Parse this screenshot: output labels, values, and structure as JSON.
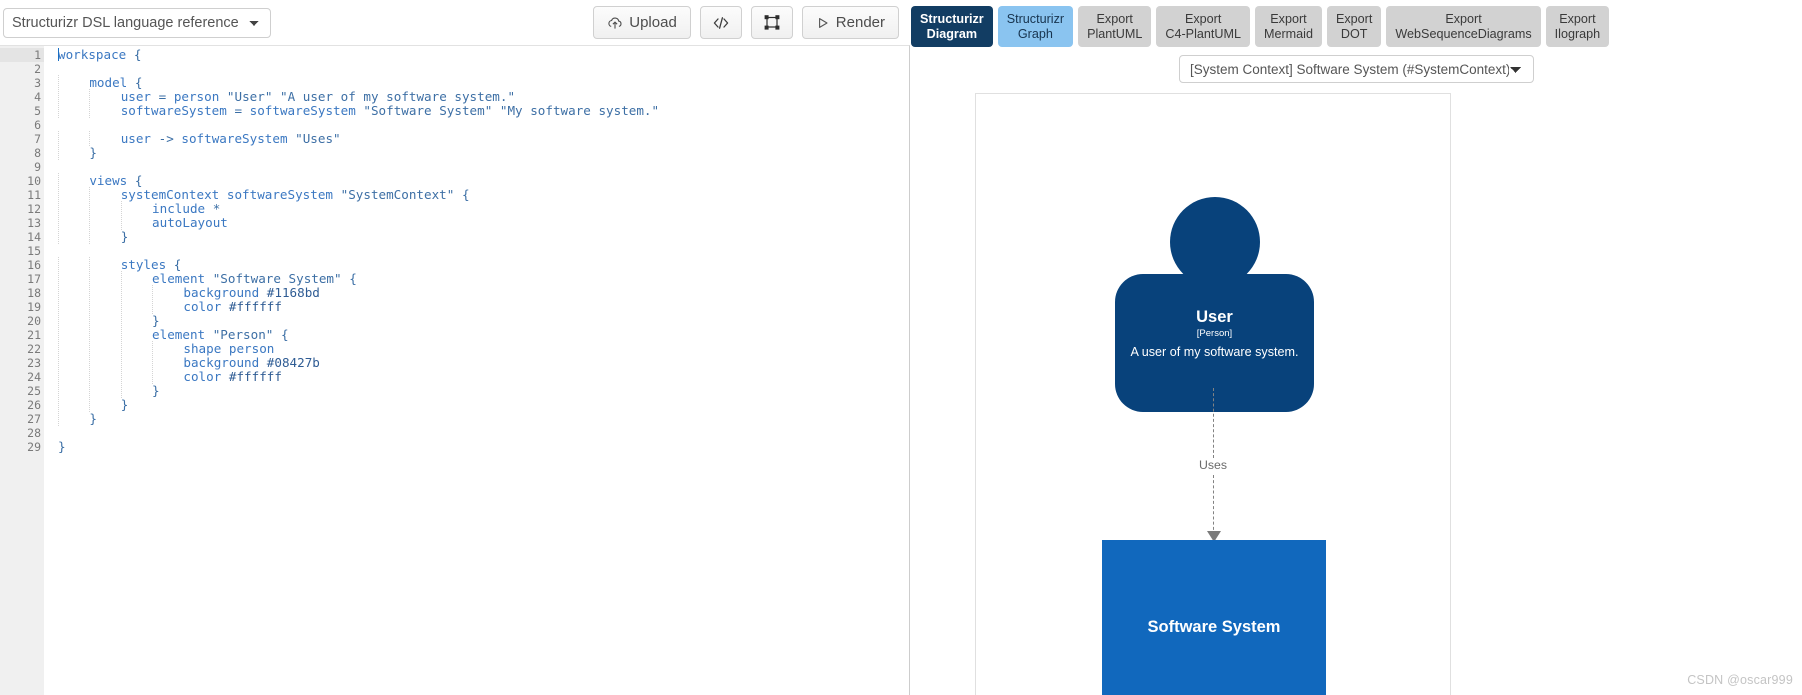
{
  "editor": {
    "language_select": {
      "value": "Structurizr DSL language reference",
      "options": [
        "Structurizr DSL language reference"
      ]
    },
    "toolbar": {
      "upload_label": "Upload",
      "code_icon": "code-brackets-icon",
      "fullscreen_icon": "bounding-box-icon",
      "render_label": "Render",
      "upload_icon": "cloud-upload-icon",
      "render_icon": "play-triangle-icon"
    },
    "lines": [
      {
        "n": 1,
        "fold": true,
        "indent": 0,
        "text": "workspace {"
      },
      {
        "n": 2,
        "fold": false,
        "indent": 0,
        "text": ""
      },
      {
        "n": 3,
        "fold": true,
        "indent": 1,
        "text": "model {"
      },
      {
        "n": 4,
        "fold": false,
        "indent": 2,
        "text": "user = person \"User\" \"A user of my software system.\""
      },
      {
        "n": 5,
        "fold": false,
        "indent": 2,
        "text": "softwareSystem = softwareSystem \"Software System\" \"My software system.\""
      },
      {
        "n": 6,
        "fold": false,
        "indent": 0,
        "text": ""
      },
      {
        "n": 7,
        "fold": false,
        "indent": 2,
        "text": "user -> softwareSystem \"Uses\""
      },
      {
        "n": 8,
        "fold": false,
        "indent": 1,
        "text": "}"
      },
      {
        "n": 9,
        "fold": false,
        "indent": 0,
        "text": ""
      },
      {
        "n": 10,
        "fold": true,
        "indent": 1,
        "text": "views {"
      },
      {
        "n": 11,
        "fold": true,
        "indent": 2,
        "text": "systemContext softwareSystem \"SystemContext\" {"
      },
      {
        "n": 12,
        "fold": false,
        "indent": 3,
        "text": "include *"
      },
      {
        "n": 13,
        "fold": false,
        "indent": 3,
        "text": "autoLayout"
      },
      {
        "n": 14,
        "fold": false,
        "indent": 2,
        "text": "}"
      },
      {
        "n": 15,
        "fold": false,
        "indent": 0,
        "text": ""
      },
      {
        "n": 16,
        "fold": true,
        "indent": 2,
        "text": "styles {"
      },
      {
        "n": 17,
        "fold": true,
        "indent": 3,
        "text": "element \"Software System\" {"
      },
      {
        "n": 18,
        "fold": false,
        "indent": 4,
        "text": "background #1168bd"
      },
      {
        "n": 19,
        "fold": false,
        "indent": 4,
        "text": "color #ffffff"
      },
      {
        "n": 20,
        "fold": false,
        "indent": 3,
        "text": "}"
      },
      {
        "n": 21,
        "fold": true,
        "indent": 3,
        "text": "element \"Person\" {"
      },
      {
        "n": 22,
        "fold": false,
        "indent": 4,
        "text": "shape person"
      },
      {
        "n": 23,
        "fold": false,
        "indent": 4,
        "text": "background #08427b"
      },
      {
        "n": 24,
        "fold": false,
        "indent": 4,
        "text": "color #ffffff"
      },
      {
        "n": 25,
        "fold": false,
        "indent": 3,
        "text": "}"
      },
      {
        "n": 26,
        "fold": false,
        "indent": 2,
        "text": "}"
      },
      {
        "n": 27,
        "fold": false,
        "indent": 1,
        "text": "}"
      },
      {
        "n": 28,
        "fold": false,
        "indent": 0,
        "text": ""
      },
      {
        "n": 29,
        "fold": false,
        "indent": 0,
        "text": "}"
      }
    ]
  },
  "preview": {
    "tabs": [
      {
        "l1": "Structurizr",
        "l2": "Diagram",
        "state": "active"
      },
      {
        "l1": "Structurizr",
        "l2": "Graph",
        "state": "selected"
      },
      {
        "l1": "Export",
        "l2": "PlantUML",
        "state": "normal"
      },
      {
        "l1": "Export",
        "l2": "C4-PlantUML",
        "state": "normal"
      },
      {
        "l1": "Export",
        "l2": "Mermaid",
        "state": "normal"
      },
      {
        "l1": "Export",
        "l2": "DOT",
        "state": "normal"
      },
      {
        "l1": "Export",
        "l2": "WebSequenceDiagrams",
        "state": "normal"
      },
      {
        "l1": "Export",
        "l2": "Ilograph",
        "state": "normal"
      }
    ],
    "view_select": {
      "value": "[System Context] Software System (#SystemContext)",
      "options": [
        "[System Context] Software System (#SystemContext)"
      ]
    }
  },
  "diagram": {
    "person": {
      "name": "User",
      "type": "[Person]",
      "description": "A user of my software system.",
      "color": "#08427b",
      "text_color": "#ffffff"
    },
    "relationship": {
      "label": "Uses",
      "line_color": "#828282"
    },
    "software_system": {
      "name": "Software System",
      "color": "#1168bd",
      "text_color": "#ffffff"
    }
  },
  "watermark": {
    "text": "CSDN @oscar999"
  }
}
